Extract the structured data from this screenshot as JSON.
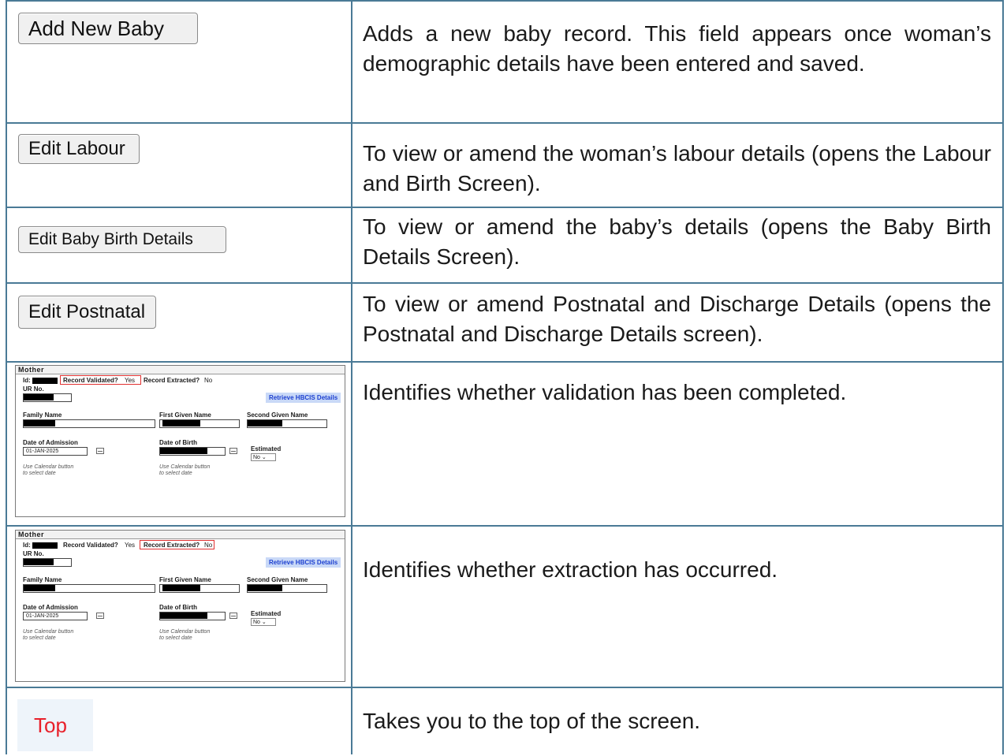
{
  "rows": [
    {
      "control": "Add New Baby",
      "description": "Adds a new baby record. This field appears once woman’s demographic details have been entered and saved."
    },
    {
      "control": "Edit Labour",
      "description": "To view or amend the woman’s labour details (opens the Labour and Birth Screen)."
    },
    {
      "control": "Edit Baby Birth Details",
      "description": "To view or amend the baby’s details (opens the Baby Birth Details Screen)."
    },
    {
      "control": "Edit Postnatal",
      "description": "To view or amend Postnatal and Discharge Details (opens the Postnatal and Discharge Details screen)."
    },
    {
      "control": "Mother",
      "description": "Identifies whether validation has been completed."
    },
    {
      "control": "Mother",
      "description": "Identifies whether extraction has occurred."
    },
    {
      "control": "Top",
      "description": "Takes you to the top of the screen."
    }
  ],
  "mother_form": {
    "title": "Mother",
    "id_label": "Id:",
    "validated_label": "Record Validated?",
    "validated_value": "Yes",
    "extracted_label": "Record Extracted?",
    "extracted_value": "No",
    "ur_label": "UR No.",
    "retrieve_button": "Retrieve HBCIS Details",
    "family_name_label": "Family Name",
    "first_given_label": "First Given Name",
    "second_given_label": "Second Given Name",
    "admission_label": "Date of Admission",
    "admission_value": "01-JAN-2025",
    "dob_label": "Date of Birth",
    "estimated_label": "Estimated",
    "estimated_value": "No",
    "calendar_hint_line1": "Use Calendar button",
    "calendar_hint_line2": "to select date"
  },
  "highlight": {
    "border_color": "#e03030",
    "rule_color": "#4a7a96",
    "top_link_color": "#e8202a"
  }
}
